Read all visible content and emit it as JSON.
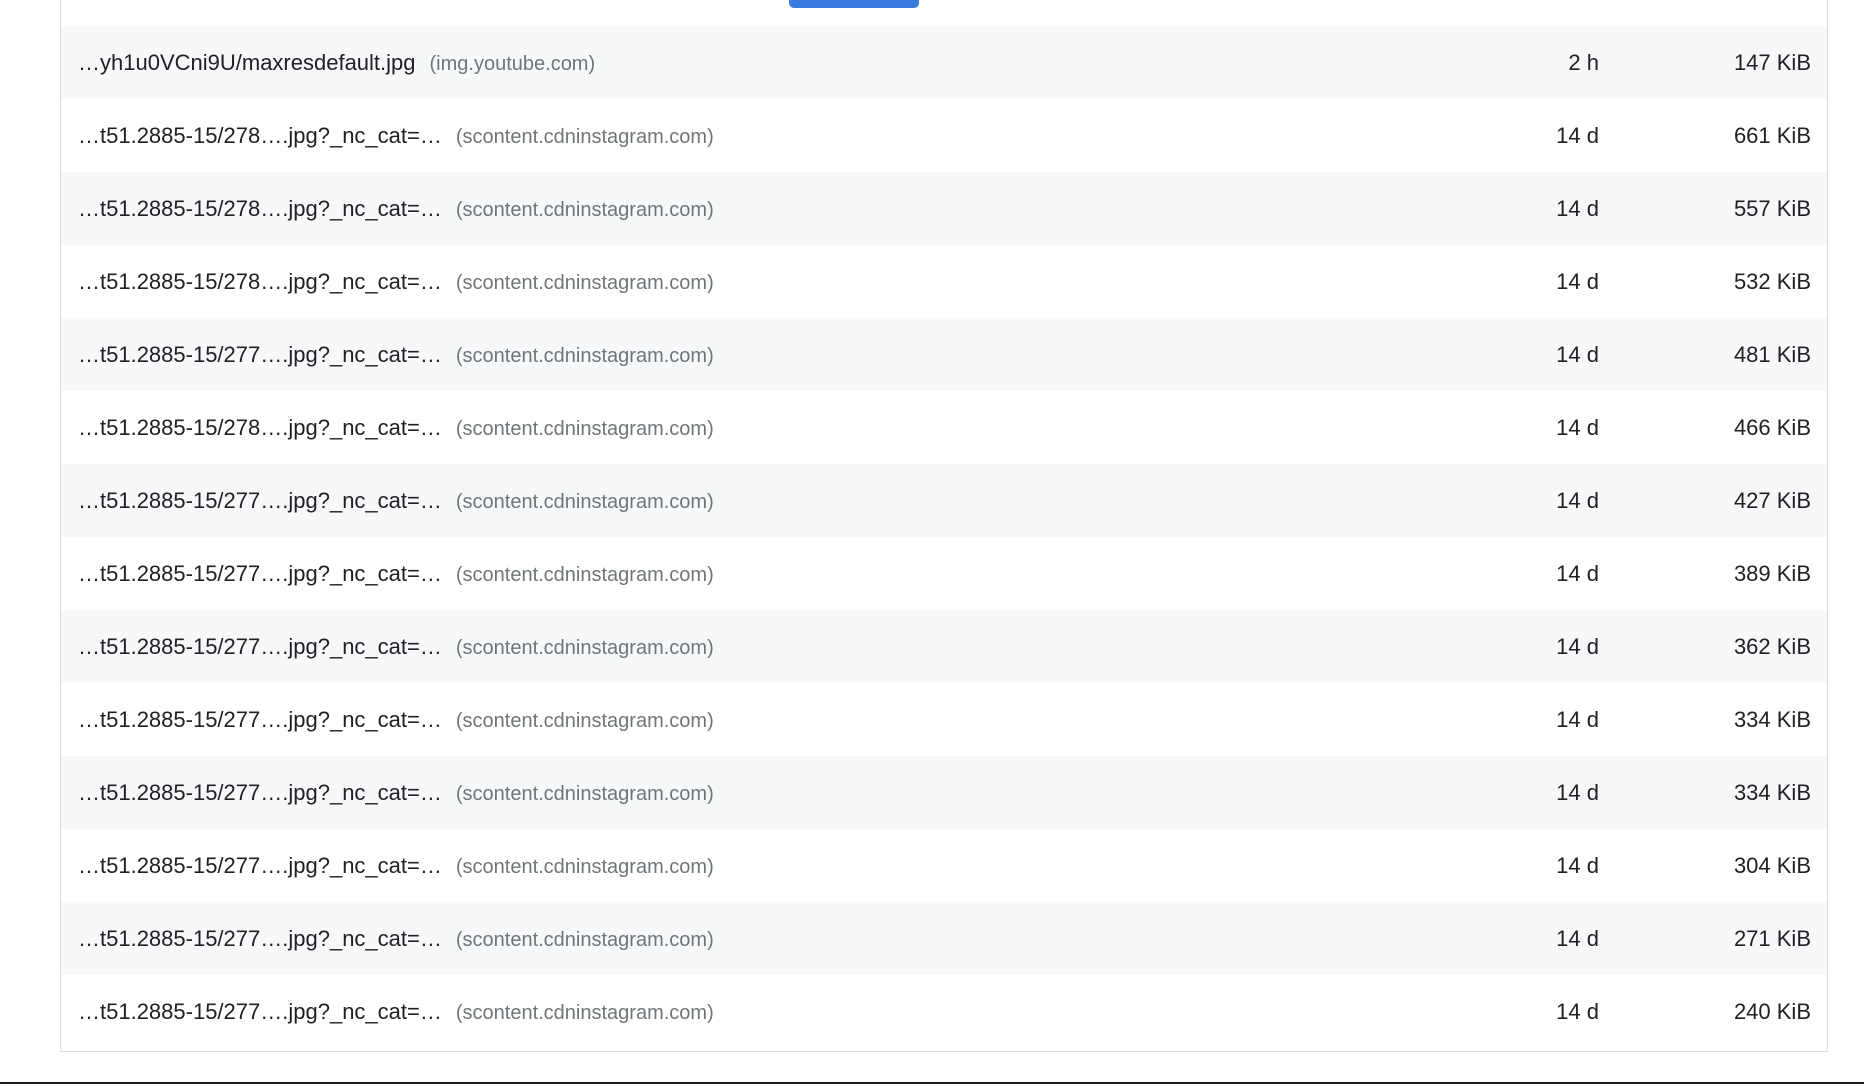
{
  "table": {
    "rows": [
      {
        "url": "…yh1u0VCni9U/maxresdefault.jpg",
        "host": "(img.youtube.com)",
        "ttl": "2 h",
        "size": "147 KiB"
      },
      {
        "url": "…t51.2885-15/278….jpg?_nc_cat=…",
        "host": "(scontent.cdninstagram.com)",
        "ttl": "14 d",
        "size": "661 KiB"
      },
      {
        "url": "…t51.2885-15/278….jpg?_nc_cat=…",
        "host": "(scontent.cdninstagram.com)",
        "ttl": "14 d",
        "size": "557 KiB"
      },
      {
        "url": "…t51.2885-15/278….jpg?_nc_cat=…",
        "host": "(scontent.cdninstagram.com)",
        "ttl": "14 d",
        "size": "532 KiB"
      },
      {
        "url": "…t51.2885-15/277….jpg?_nc_cat=…",
        "host": "(scontent.cdninstagram.com)",
        "ttl": "14 d",
        "size": "481 KiB"
      },
      {
        "url": "…t51.2885-15/278….jpg?_nc_cat=…",
        "host": "(scontent.cdninstagram.com)",
        "ttl": "14 d",
        "size": "466 KiB"
      },
      {
        "url": "…t51.2885-15/277….jpg?_nc_cat=…",
        "host": "(scontent.cdninstagram.com)",
        "ttl": "14 d",
        "size": "427 KiB"
      },
      {
        "url": "…t51.2885-15/277….jpg?_nc_cat=…",
        "host": "(scontent.cdninstagram.com)",
        "ttl": "14 d",
        "size": "389 KiB"
      },
      {
        "url": "…t51.2885-15/277….jpg?_nc_cat=…",
        "host": "(scontent.cdninstagram.com)",
        "ttl": "14 d",
        "size": "362 KiB"
      },
      {
        "url": "…t51.2885-15/277….jpg?_nc_cat=…",
        "host": "(scontent.cdninstagram.com)",
        "ttl": "14 d",
        "size": "334 KiB"
      },
      {
        "url": "…t51.2885-15/277….jpg?_nc_cat=…",
        "host": "(scontent.cdninstagram.com)",
        "ttl": "14 d",
        "size": "334 KiB"
      },
      {
        "url": "…t51.2885-15/277….jpg?_nc_cat=…",
        "host": "(scontent.cdninstagram.com)",
        "ttl": "14 d",
        "size": "304 KiB"
      },
      {
        "url": "…t51.2885-15/277….jpg?_nc_cat=…",
        "host": "(scontent.cdninstagram.com)",
        "ttl": "14 d",
        "size": "271 KiB"
      },
      {
        "url": "…t51.2885-15/277….jpg?_nc_cat=…",
        "host": "(scontent.cdninstagram.com)",
        "ttl": "14 d",
        "size": "240 KiB"
      }
    ]
  },
  "colors": {
    "accent": "#3a7be0",
    "row_alt": "#f7f8fa",
    "text": "#202124",
    "muted": "#70757a"
  }
}
